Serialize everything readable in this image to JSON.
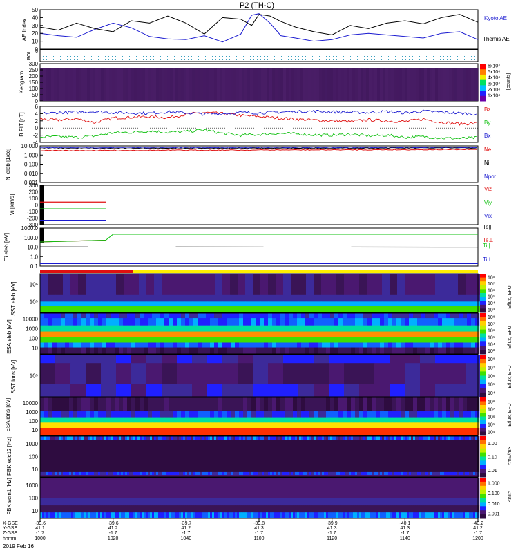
{
  "title": "P2 (TH-C)",
  "colors": {
    "blue": "#1a1ad0",
    "red": "#e01010",
    "green": "#10c010",
    "black": "#000000",
    "dark_purple": "#2e0c40",
    "purple": "#4a1870",
    "yellow": "#ffee00"
  },
  "time_axis": {
    "labels": [
      "1000",
      "1020",
      "1040",
      "1100",
      "1120",
      "1140",
      "1200"
    ],
    "x_gse": [
      "-39.6",
      "-39.6",
      "-39.7",
      "-39.8",
      "-39.9",
      "-40.1",
      "-40.2"
    ],
    "y_gse": [
      "41.1",
      "41.2",
      "41.2",
      "41.3",
      "41.3",
      "41.3",
      "41.2"
    ],
    "z_gse": [
      "-1.7",
      "-1.7",
      "-1.7",
      "-1.7",
      "-1.7",
      "-1.7",
      "-1.7"
    ],
    "row_labels": [
      "X-GSE",
      "Y-GSE",
      "Z-GSE",
      "hhmm"
    ],
    "date": "2019 Feb 16"
  },
  "chart_data": [
    {
      "type": "line",
      "panel": "ae",
      "ylabel": "AE Index",
      "ylim": [
        0,
        50
      ],
      "yticks": [
        "0",
        "10",
        "20",
        "30",
        "40",
        "50"
      ],
      "series": [
        {
          "name": "Kyoto AE",
          "color": "blue",
          "x": [
            1000,
            1005,
            1010,
            1015,
            1020,
            1025,
            1030,
            1035,
            1040,
            1045,
            1050,
            1055,
            1058,
            1100,
            1103,
            1106,
            1110,
            1115,
            1120,
            1125,
            1130,
            1135,
            1140,
            1145,
            1150,
            1155,
            1200
          ],
          "values": [
            20,
            17,
            15,
            25,
            33,
            27,
            16,
            13,
            12,
            17,
            9,
            19,
            43,
            45,
            33,
            17,
            14,
            10,
            12,
            18,
            20,
            18,
            16,
            14,
            20,
            22,
            12
          ]
        },
        {
          "name": "Themis AE",
          "color": "black",
          "x": [
            1000,
            1005,
            1010,
            1015,
            1020,
            1025,
            1030,
            1035,
            1040,
            1045,
            1050,
            1055,
            1058,
            1100,
            1103,
            1106,
            1110,
            1115,
            1120,
            1125,
            1130,
            1135,
            1140,
            1145,
            1150,
            1155,
            1200
          ],
          "values": [
            28,
            24,
            33,
            26,
            22,
            36,
            33,
            42,
            33,
            19,
            40,
            38,
            30,
            44,
            42,
            35,
            28,
            22,
            18,
            30,
            26,
            33,
            36,
            32,
            40,
            44,
            34
          ]
        }
      ]
    },
    {
      "type": "line",
      "panel": "roi",
      "ylabel": "ROI",
      "ytick": "0"
    },
    {
      "type": "heatmap",
      "panel": "keogram",
      "ylabel": "Keogram",
      "yticks": [
        "0",
        "50",
        "100",
        "150",
        "200",
        "250",
        "300"
      ],
      "ylim": [
        0,
        300
      ],
      "colorbar_label": "[counts]",
      "colorbar_ticks": [
        "1x10⁴",
        "2x10⁴",
        "3x10⁴",
        "4x10⁴",
        "5x10⁴",
        "6x10⁴"
      ]
    },
    {
      "type": "line",
      "panel": "bfield",
      "ylabel": "B FIT [nT]",
      "ylim": [
        -4,
        6
      ],
      "yticks": [
        "-4",
        "-2",
        "0",
        "2",
        "4",
        "6"
      ],
      "series": [
        {
          "name": "Bz",
          "color": "red",
          "x": [
            1000,
            1005,
            1010,
            1015,
            1020,
            1025,
            1030,
            1035,
            1040,
            1045,
            1050,
            1055,
            1100,
            1105,
            1110,
            1115,
            1120,
            1125,
            1130,
            1135,
            1140,
            1145,
            1150,
            1155,
            1200
          ],
          "values": [
            2.5,
            2.2,
            2.6,
            1.5,
            2.8,
            3.0,
            3.2,
            2.9,
            3.8,
            4.3,
            4.0,
            3.5,
            3.2,
            2.8,
            2.5,
            2.2,
            2.0,
            1.8,
            2.3,
            2.0,
            1.8,
            2.5,
            1.6,
            1.2,
            1.3
          ]
        },
        {
          "name": "By",
          "color": "green",
          "x": [
            1000,
            1005,
            1010,
            1015,
            1020,
            1025,
            1030,
            1035,
            1040,
            1045,
            1050,
            1055,
            1100,
            1105,
            1110,
            1115,
            1120,
            1125,
            1130,
            1135,
            1140,
            1145,
            1150,
            1155,
            1200
          ],
          "values": [
            -2.5,
            -2.4,
            -2.6,
            -2.2,
            -1.3,
            -1.2,
            -0.8,
            -1.2,
            -1.0,
            -0.5,
            -1.5,
            -2.0,
            -1.8,
            -1.5,
            -1.6,
            -1.9,
            -2.0,
            -1.7,
            -2.2,
            -2.0,
            -2.6,
            -2.4,
            -2.8,
            -2.9,
            -2.7
          ]
        },
        {
          "name": "Bx",
          "color": "blue",
          "x": [
            1000,
            1005,
            1010,
            1015,
            1020,
            1025,
            1030,
            1035,
            1040,
            1045,
            1050,
            1055,
            1100,
            1105,
            1110,
            1115,
            1120,
            1125,
            1130,
            1135,
            1140,
            1145,
            1150,
            1155,
            1200
          ],
          "values": [
            4.0,
            4.3,
            4.4,
            4.6,
            4.3,
            4.2,
            4.1,
            4.5,
            4.2,
            3.9,
            4.0,
            4.3,
            4.2,
            4.4,
            4.6,
            4.7,
            4.5,
            4.4,
            4.3,
            4.6,
            4.2,
            4.7,
            4.4,
            4.1,
            3.9
          ]
        }
      ]
    },
    {
      "type": "line",
      "panel": "density",
      "ylabel": "Ni eleb [1/cc]",
      "ylim": [
        0.001,
        10
      ],
      "yticks": [
        "0.001",
        "0.010",
        "0.100",
        "1.000",
        "10.000"
      ],
      "series": [
        {
          "name": "Ne",
          "color": "red",
          "x": [
            1000,
            1200
          ],
          "values": [
            3,
            4
          ]
        },
        {
          "name": "Ni",
          "color": "black",
          "x": [
            1000,
            1200
          ],
          "values": [
            5,
            6
          ]
        },
        {
          "name": "Npot",
          "color": "blue",
          "x": [
            1000,
            1200
          ],
          "values": [
            6.5,
            7
          ]
        }
      ]
    },
    {
      "type": "line",
      "panel": "velocity",
      "ylabel": "Vi [km/s]",
      "ylim": [
        -400,
        400
      ],
      "yticks": [
        "-300",
        "-200",
        "-100",
        "0",
        "100",
        "200",
        "300"
      ],
      "series": [
        {
          "name": "Viz",
          "color": "red",
          "x": [
            1000,
            1018
          ],
          "values": [
            60,
            60
          ]
        },
        {
          "name": "Viy",
          "color": "green",
          "x": [
            1000,
            1018
          ],
          "values": [
            -80,
            -80
          ]
        },
        {
          "name": "Vix",
          "color": "blue",
          "x": [
            1000,
            1018
          ],
          "values": [
            -310,
            -310
          ]
        }
      ]
    },
    {
      "type": "line",
      "panel": "temperature",
      "ylabel": "Ti eleb [eV]",
      "ylim": [
        0.05,
        3000
      ],
      "yticks": [
        "0.1",
        "1.0",
        "10.0",
        "100.0",
        "1000.0"
      ],
      "series": [
        {
          "name": "Te||",
          "color": "black",
          "x": [
            1000,
            1200
          ],
          "values": [
            13,
            12
          ]
        },
        {
          "name": "Te⊥",
          "color": "red",
          "x": [
            1000,
            1018
          ],
          "values": [
            55,
            90
          ]
        },
        {
          "name": "Ti||",
          "color": "green",
          "x": [
            1000,
            1018,
            1020,
            1200
          ],
          "values": [
            55,
            90,
            500,
            500
          ]
        },
        {
          "name": "Ti⊥",
          "color": "blue",
          "x": [
            1000,
            1200
          ],
          "values": [
            0.1,
            0.1
          ]
        }
      ]
    },
    {
      "type": "heatmap",
      "panel": "sst1",
      "ylabel": "SST eleb [eV]",
      "yticks": [
        "10⁵",
        "10⁶"
      ],
      "colorbar_label": "Eflux, EFU",
      "colorbar_ticks": [
        "10³",
        "10⁴",
        "10⁵",
        "10⁶",
        "10⁷",
        "10⁸"
      ]
    },
    {
      "type": "heatmap",
      "panel": "esa1",
      "ylabel": "ESA eleb [eV]",
      "yticks": [
        "10",
        "100",
        "1000",
        "10000"
      ],
      "colorbar_label": "Eflux, EFU",
      "colorbar_ticks": [
        "10³",
        "10⁴",
        "10⁵",
        "10⁶",
        "10⁷",
        "10⁸"
      ]
    },
    {
      "type": "heatmap",
      "panel": "sst2",
      "ylabel": "SST ions [eV]",
      "yticks": [
        "10⁵"
      ],
      "colorbar_label": "Eflux, EFU",
      "colorbar_ticks": [
        "10⁴",
        "10⁵",
        "10⁶",
        "10⁷",
        "10⁸"
      ]
    },
    {
      "type": "heatmap",
      "panel": "esa2",
      "ylabel": "ESA ions [eV]",
      "yticks": [
        "10",
        "100",
        "1000",
        "10000"
      ],
      "colorbar_label": "Eflux, EFU",
      "colorbar_ticks": [
        "10⁴",
        "10⁵",
        "10⁶",
        "10⁷",
        "10⁸"
      ]
    },
    {
      "type": "heatmap",
      "panel": "fbk1",
      "ylabel": "FBK edc12 [Hz]",
      "yticks": [
        "10",
        "100",
        "1000"
      ],
      "colorbar_label": "<mV/m>",
      "colorbar_ticks": [
        "0.01",
        "0.10",
        "1.00"
      ]
    },
    {
      "type": "heatmap",
      "panel": "fbk2",
      "ylabel": "FBK scm1 [Hz]",
      "yticks": [
        "10",
        "100",
        "1000"
      ],
      "colorbar_label": "<nT>",
      "colorbar_ticks": [
        "0.001",
        "0.010",
        "0.100",
        "1.000"
      ]
    }
  ]
}
